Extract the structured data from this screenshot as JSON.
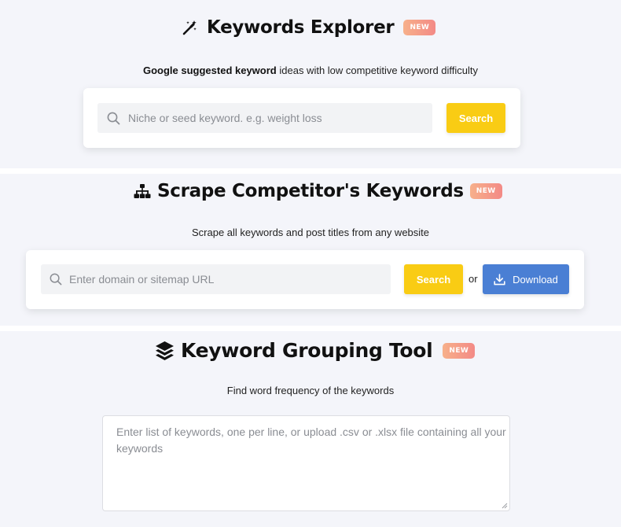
{
  "keywords_explorer": {
    "title": "Keywords Explorer",
    "badge": "NEW",
    "subtitle_bold": "Google suggested keyword",
    "subtitle_rest": " ideas with low competitive keyword difficulty",
    "search_placeholder": "Niche or seed keyword. e.g. weight loss",
    "search_button": "Search",
    "icon": "magic-wand-icon"
  },
  "scrape_competitor": {
    "title": "Scrape Competitor's Keywords",
    "badge": "NEW",
    "subtitle": "Scrape all keywords and post titles from any website",
    "domain_placeholder": "Enter domain or sitemap URL",
    "search_button": "Search",
    "or_text": "or",
    "download_button": "Download",
    "icon": "sitemap-icon"
  },
  "keyword_grouping": {
    "title": "Keyword Grouping Tool",
    "badge": "NEW",
    "subtitle": "Find word frequency of the keywords",
    "textarea_placeholder": "Enter list of keywords, one per line, or upload .csv or .xlsx file containing all your keywords",
    "icon": "layers-icon"
  },
  "colors": {
    "accent_yellow": "#f9cc14",
    "accent_blue": "#4a7fd4",
    "badge_gradient_start": "#f7b08a",
    "badge_gradient_end": "#f38a86",
    "background": "#f4f5fa"
  }
}
